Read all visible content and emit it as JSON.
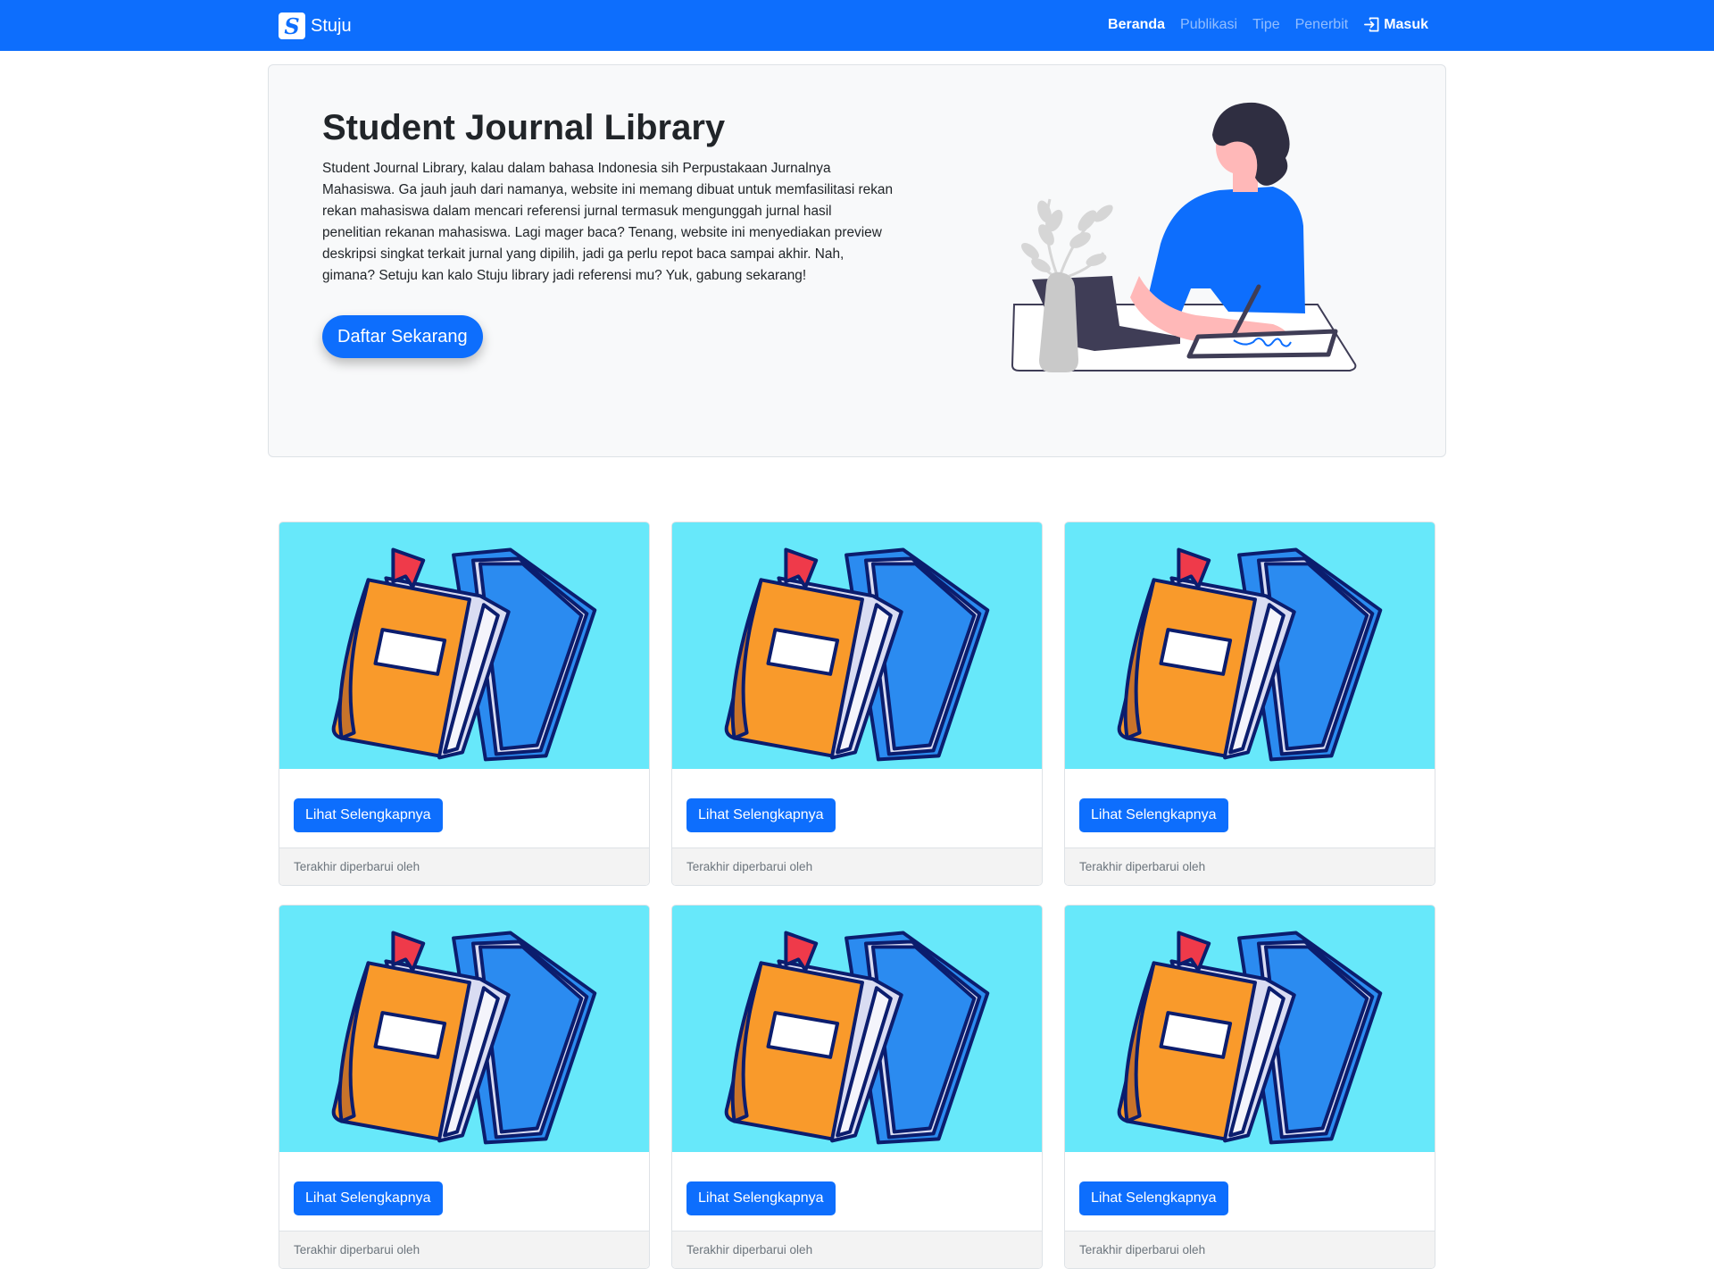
{
  "navbar": {
    "brand_logo": "S",
    "brand_name": "Stuju",
    "links": [
      {
        "label": "Beranda",
        "active": true
      },
      {
        "label": "Publikasi",
        "active": false
      },
      {
        "label": "Tipe",
        "active": false
      },
      {
        "label": "Penerbit",
        "active": false
      }
    ],
    "login_label": "Masuk",
    "login_icon": "login-icon"
  },
  "hero": {
    "title": "Student Journal Library",
    "description": "Student Journal Library, kalau dalam bahasa Indonesia sih Perpustakaan Jurnalnya Mahasiswa. Ga jauh jauh dari namanya, website ini memang dibuat untuk memfasilitasi rekan rekan mahasiswa dalam mencari referensi jurnal termasuk mengunggah jurnal hasil penelitian rekanan mahasiswa. Lagi mager baca? Tenang, website ini menyediakan preview deskripsi singkat terkait jurnal yang dipilih, jadi ga perlu repot baca sampai akhir. Nah, gimana? Setuju kan kalo Stuju library jadi referensi mu? Yuk, gabung sekarang!",
    "cta_label": "Daftar Sekarang"
  },
  "cards": [
    {
      "button_label": "Lihat Selengkapnya",
      "footer": "Terakhir diperbarui oleh"
    },
    {
      "button_label": "Lihat Selengkapnya",
      "footer": "Terakhir diperbarui oleh"
    },
    {
      "button_label": "Lihat Selengkapnya",
      "footer": "Terakhir diperbarui oleh"
    },
    {
      "button_label": "Lihat Selengkapnya",
      "footer": "Terakhir diperbarui oleh"
    },
    {
      "button_label": "Lihat Selengkapnya",
      "footer": "Terakhir diperbarui oleh"
    },
    {
      "button_label": "Lihat Selengkapnya",
      "footer": "Terakhir diperbarui oleh"
    }
  ],
  "colors": {
    "primary": "#0d6efd",
    "card_image_bg": "#67e8fa",
    "hero_bg": "#f8f9fa",
    "book_orange": "#f99a2b",
    "book_blue": "#2b8bf0",
    "bookmark_red": "#ef3a4a"
  }
}
